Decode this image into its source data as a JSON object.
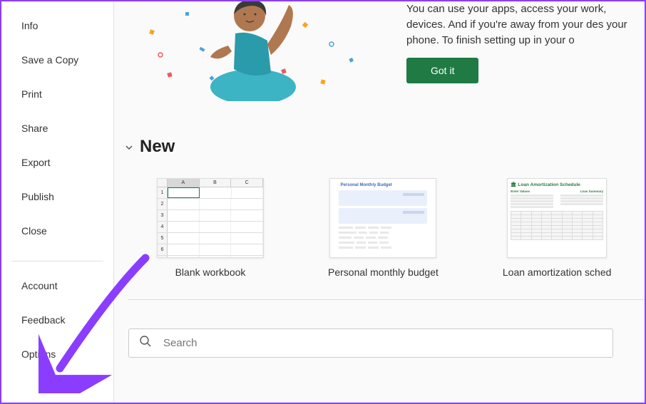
{
  "sidebar": {
    "main": [
      {
        "label": "Info"
      },
      {
        "label": "Save a Copy"
      },
      {
        "label": "Print"
      },
      {
        "label": "Share"
      },
      {
        "label": "Export"
      },
      {
        "label": "Publish"
      },
      {
        "label": "Close"
      }
    ],
    "bottom": [
      {
        "label": "Account"
      },
      {
        "label": "Feedback"
      },
      {
        "label": "Options"
      }
    ]
  },
  "hero": {
    "text": "You can use your apps, access your work, devices. And if you're away from your des your phone. To finish setting up in your o",
    "button": "Got it"
  },
  "section": {
    "title": "New"
  },
  "templates": [
    {
      "label": "Blank workbook"
    },
    {
      "label": "Personal monthly budget"
    },
    {
      "label": "Loan amortization sched"
    }
  ],
  "search": {
    "placeholder": "Search"
  },
  "colors": {
    "accent": "#1f7a44",
    "annotation": "#8b3dff"
  }
}
